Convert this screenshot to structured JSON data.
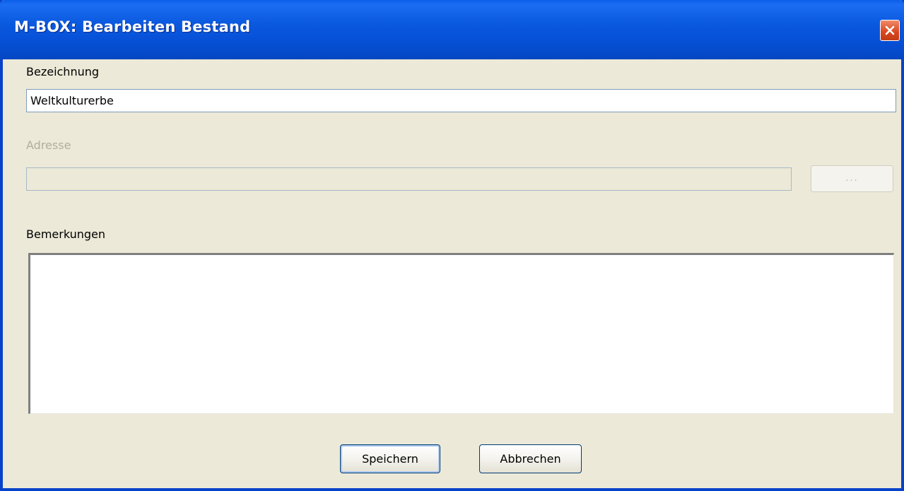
{
  "window": {
    "title": "M-BOX: Bearbeiten Bestand"
  },
  "form": {
    "bezeichnung_label": "Bezeichnung",
    "bezeichnung_value": "Weltkulturerbe",
    "adresse_label": "Adresse",
    "adresse_value": "",
    "browse_label": "...",
    "bemerkungen_label": "Bemerkungen",
    "bemerkungen_value": ""
  },
  "buttons": {
    "save_label": "Speichern",
    "cancel_label": "Abbrechen"
  },
  "colors": {
    "titlebar": "#0a59df",
    "window_bg": "#ece9d8",
    "close_button": "#d8461e"
  },
  "icons": {
    "close": "close-icon"
  }
}
